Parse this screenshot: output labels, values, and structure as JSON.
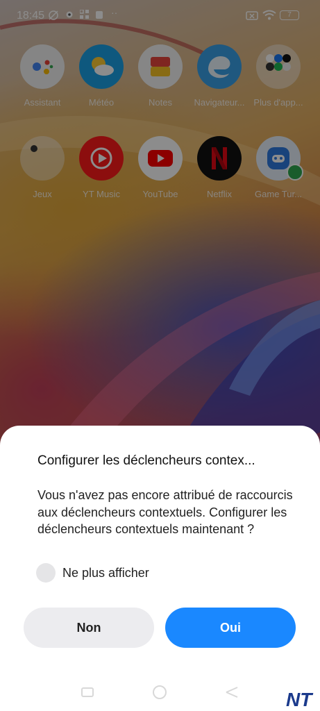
{
  "status_bar": {
    "time": "18:45",
    "battery_level": "7",
    "icons": [
      "mute-alarm-icon",
      "gear-icon",
      "apps-icon",
      "notification-icon",
      "more-icon",
      "sim-x-icon",
      "wifi-icon",
      "battery-icon"
    ]
  },
  "apps_row1": [
    {
      "name": "Assistant",
      "icon": "assistant-icon"
    },
    {
      "name": "Météo",
      "icon": "weather-icon"
    },
    {
      "name": "Notes",
      "icon": "notes-icon"
    },
    {
      "name": "Navigateur...",
      "icon": "browser-icon"
    },
    {
      "name": "Plus d'app...",
      "icon": "folder-icon"
    }
  ],
  "apps_row2": [
    {
      "name": "Jeux",
      "icon": "games-folder-icon"
    },
    {
      "name": "YT Music",
      "icon": "yt-music-icon"
    },
    {
      "name": "YouTube",
      "icon": "youtube-icon"
    },
    {
      "name": "Netflix",
      "icon": "netflix-icon"
    },
    {
      "name": "Game Tur...",
      "icon": "game-turbo-icon"
    }
  ],
  "dialog": {
    "title": "Configurer les déclencheurs contex...",
    "message": "Vous n'avez pas encore attribué de raccourcis aux déclencheurs contextuels. Configurer les déclencheurs contextuels maintenant ?",
    "checkbox_label": "Ne plus afficher",
    "checkbox_checked": false,
    "no_label": "Non",
    "yes_label": "Oui"
  },
  "watermark": "NT",
  "colors": {
    "primary": "#1a88ff",
    "secondary_button": "#ececef"
  }
}
